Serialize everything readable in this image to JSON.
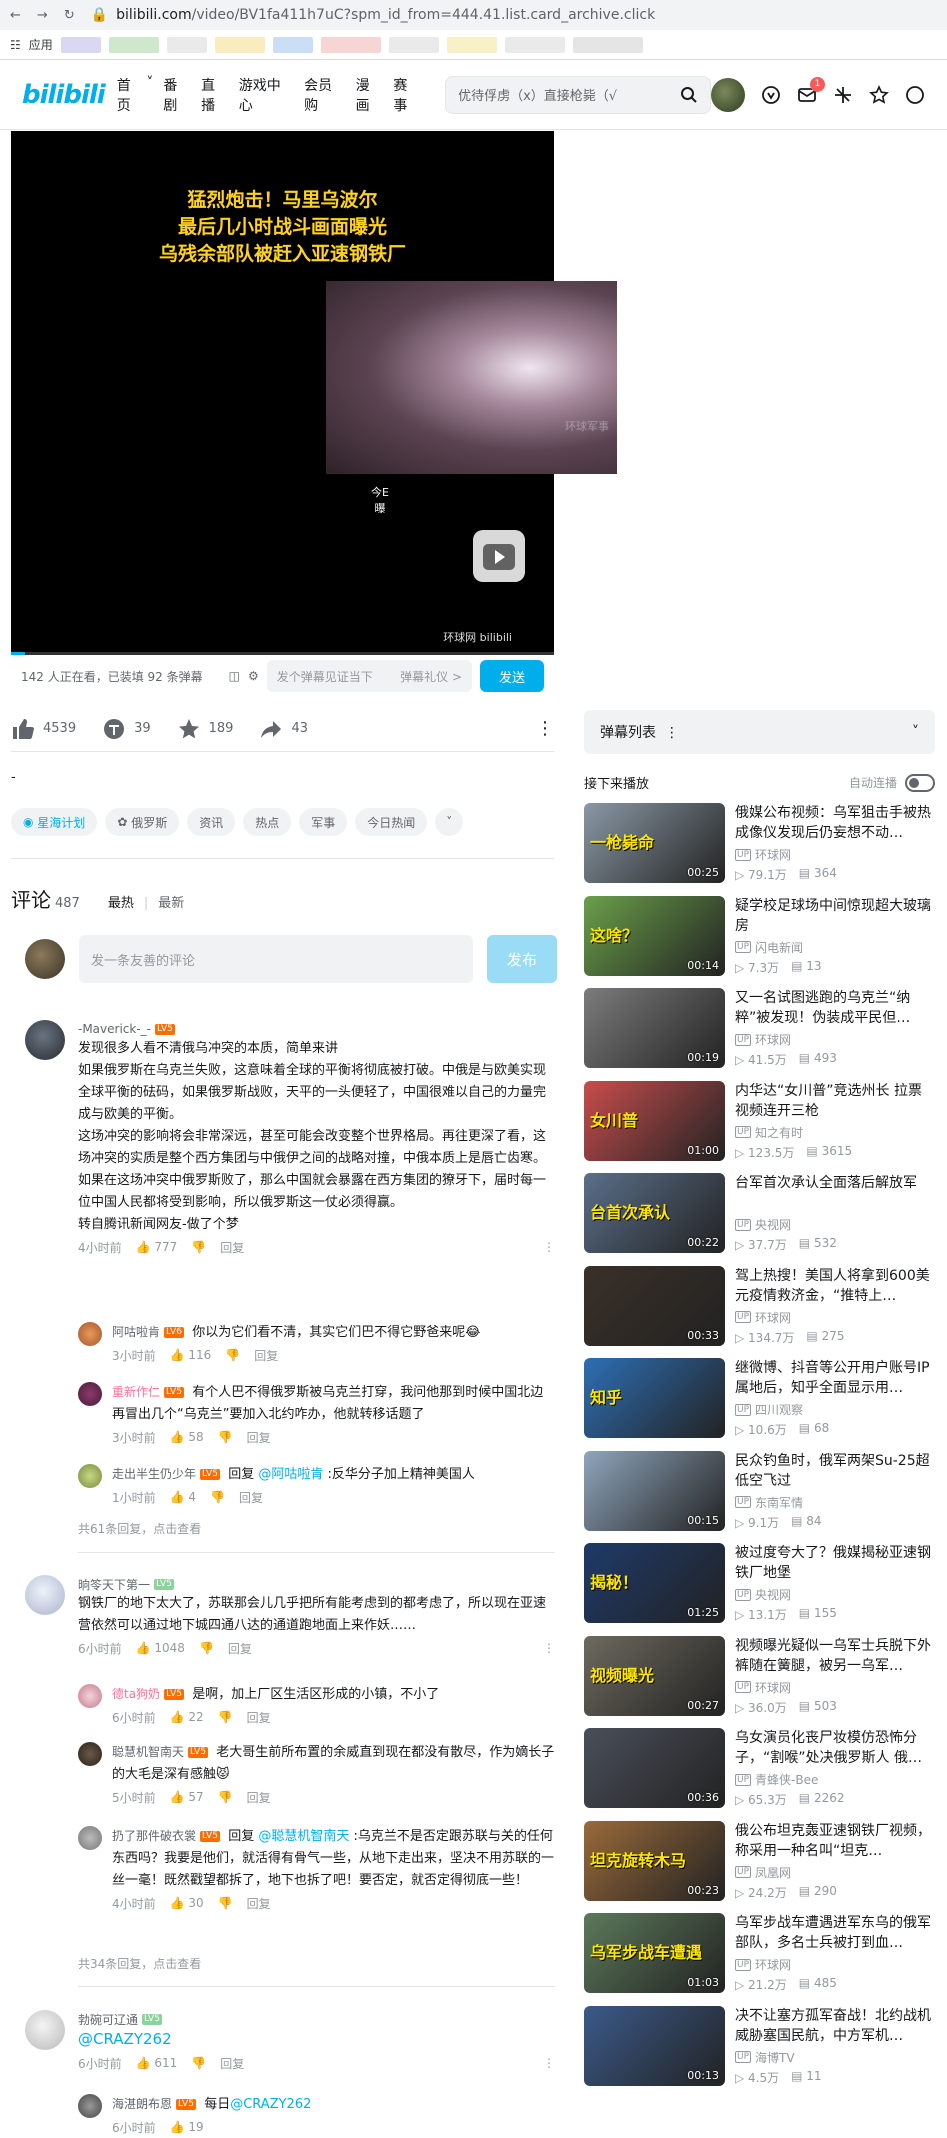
{
  "browser": {
    "url_host": "bilibili.com",
    "url_rest": "/video/BV1fa411h7uC?spm_id_from=444.41.list.card_archive.click",
    "apps_label": "应用"
  },
  "header": {
    "logo": "bilibili",
    "nav": [
      "首页",
      "番剧",
      "直播",
      "游戏中心",
      "会员购",
      "漫画",
      "赛事"
    ],
    "search_placeholder": "优待俘虏（x）直接枪毙（√",
    "badge": "1"
  },
  "player": {
    "title_lines": [
      "猛烈炮击！马里乌波尔",
      "最后几小时战斗画面曝光",
      "乌残余部队被赶入亚速钢铁厂"
    ],
    "frame_watermark": "环球军事",
    "caption_lines": [
      "今E",
      "曝"
    ],
    "watermark": "环球网 bilibili"
  },
  "danmaku_bar": {
    "watching": "142 人正在看，已装填 92 条弹幕",
    "placeholder": "发个弹幕见证当下",
    "etiquette": "弹幕礼仪 >",
    "send": "发送"
  },
  "toolbar": {
    "like": "4539",
    "coin": "39",
    "fav": "189",
    "share": "43"
  },
  "desc": "-",
  "tags": [
    "星海计划",
    "俄罗斯",
    "资讯",
    "热点",
    "军事",
    "今日热闻"
  ],
  "comments_header": {
    "title": "评论",
    "count": "487",
    "sort_hot": "最热",
    "sort_new": "最新"
  },
  "comment_input": {
    "placeholder": "发一条友善的评论",
    "button": "发布"
  },
  "comments": [
    {
      "user": "-Maverick-_-",
      "level": "LV5",
      "lines": [
        "发现很多人看不清俄乌冲突的本质，简单来讲",
        "如果俄罗斯在乌克兰失败，这意味着全球的平衡将彻底被打破。中俄是与欧美实现全球平衡的砝码，如果俄罗斯战败，天平的一头便轻了，中国很难以自己的力量完成与欧美的平衡。",
        "这场冲突的影响将会非常深远，甚至可能会改变整个世界格局。再往更深了看，这场冲突的实质是整个西方集团与中俄伊之间的战略对撞，中俄本质上是唇亡齿寒。",
        "如果在这场冲突中俄罗斯败了，那么中国就会暴露在西方集团的獠牙下，届时每一位中国人民都将受到影响，所以俄罗斯这一仗必须得赢。",
        "转自腾讯新闻网友-做了个梦"
      ],
      "time": "4小时前",
      "likes": "777",
      "reply": "回复",
      "replies": [
        {
          "user": "阿咕啦肯",
          "level": "LV6",
          "text": "你以为它们看不清，其实它们巴不得它野爸来呢😂",
          "time": "3小时前",
          "likes": "116"
        },
        {
          "user": "重新作仁",
          "level": "LV5",
          "text": "有个人巴不得俄罗斯被乌克兰打穿，我问他那到时候中国北边再冒出几个“乌克兰”要加入北约咋办，他就转移话题了",
          "time": "3小时前",
          "likes": "58"
        },
        {
          "user": "走出半生仍少年",
          "level": "LV5",
          "text_prefix": "回复 ",
          "mention": "@阿咕啦肯",
          "text": " :反华分子加上精神美国人",
          "time": "1小时前",
          "likes": "4"
        }
      ],
      "more": "共61条回复，点击查看"
    },
    {
      "user": "晌笭天下第一",
      "level": "LV5",
      "lines": [
        "钢铁厂的地下太大了，苏联那会儿几乎把所有能考虑到的都考虑了，所以现在亚速营依然可以通过地下城四通八达的通道跑地面上来作妖……"
      ],
      "time": "6小时前",
      "likes": "1048",
      "reply": "回复",
      "replies": [
        {
          "user": "德ta狗奶",
          "level": "LV5",
          "text": "是啊，加上厂区生活区形成的小镇，不小了",
          "time": "6小时前",
          "likes": "22"
        },
        {
          "user": "聪慧机智南天",
          "level": "LV5",
          "text": "老大哥生前所布置的余威直到现在都没有散尽，作为嫡长子的大毛是深有感触😾",
          "time": "5小时前",
          "likes": "57"
        },
        {
          "user": "扔了那件破衣裳",
          "level": "LV5",
          "text_prefix": "回复 ",
          "mention": "@聪慧机智南天",
          "text": " :乌克兰不是否定跟苏联与关的任何东西吗？我要是他们，就活得有骨气一些，从地下走出来，坚决不用苏联的一丝一毫！既然戳望都拆了，地下也拆了吧！要否定，就否定得彻底一些！",
          "time": "4小时前",
          "likes": "30"
        }
      ],
      "more": "共34条回复，点击查看"
    },
    {
      "user": "勃碗可辽通",
      "level": "LV5",
      "mention_line": "@CRAZY262",
      "time": "6小时前",
      "likes": "611",
      "reply": "回复",
      "replies": [
        {
          "user": "海湛朗布恩",
          "level": "LV5",
          "text": "每日",
          "mention": "@CRAZY262",
          "time": "6小时前",
          "likes": "19"
        }
      ]
    }
  ],
  "sidebar": {
    "danmaku_list": "弹幕列表",
    "next_label": "接下来播放",
    "autoplay": "自动连播",
    "recs": [
      {
        "title": "俄媒公布视频：乌军狙击手被热成像仪发现后仍妄想不动…",
        "up": "环球网",
        "views": "79.1万",
        "dm": "364",
        "dur": "00:25",
        "tt": "一枪毙命",
        "bg": "#8a99a6"
      },
      {
        "title": "疑学校足球场中间惊现超大玻璃房",
        "up": "闪电新闻",
        "views": "7.3万",
        "dm": "13",
        "dur": "00:14",
        "tt": "这啥？",
        "bg": "#6aa04a"
      },
      {
        "title": "又一名试图逃跑的乌克兰“纳粹”被发现！伪装成平民但…",
        "up": "环球网",
        "views": "41.5万",
        "dm": "493",
        "dur": "00:19",
        "tt": "",
        "bg": "#7c7c7c"
      },
      {
        "title": "内华达“女川普”竞选州长 拉票视频连开三枪",
        "up": "知之有时",
        "views": "123.5万",
        "dm": "3615",
        "dur": "01:00",
        "tt": "女川普",
        "bg": "#c94d4d"
      },
      {
        "title": "台军首次承认全面落后解放军",
        "up": "央视网",
        "views": "37.7万",
        "dm": "532",
        "dur": "00:22",
        "tt": "台首次承认",
        "bg": "#5a6f8a"
      },
      {
        "title": "驾上热搜！美国人将拿到600美元疫情救济金，“推特上…",
        "up": "环球网",
        "views": "134.7万",
        "dm": "275",
        "dur": "00:33",
        "tt": "",
        "bg": "#3a3028"
      },
      {
        "title": "继微博、抖音等公开用户账号IP属地后，知乎全面显示用…",
        "up": "四川观察",
        "views": "10.6万",
        "dm": "68",
        "dur": "",
        "tt": "知乎",
        "bg": "#2d6fb5"
      },
      {
        "title": "民众钓鱼时，俄军两架Su-25超低空飞过",
        "up": "东南军情",
        "views": "9.1万",
        "dm": "84",
        "dur": "00:15",
        "tt": "",
        "bg": "#8fa6bd"
      },
      {
        "title": "被过度夸大了？俄媒揭秘亚速钢铁厂地堡",
        "up": "央视网",
        "views": "13.1万",
        "dm": "155",
        "dur": "01:25",
        "tt": "揭秘！",
        "bg": "#1e3a6a"
      },
      {
        "title": "视频曝光疑似一乌军士兵脱下外裤随在簧腿，被另一乌军…",
        "up": "环球网",
        "views": "36.0万",
        "dm": "503",
        "dur": "00:27",
        "tt": "视频曝光",
        "bg": "#6d6a5e"
      },
      {
        "title": "乌女演员化丧尸妆模仿恐怖分子，“割喉”处决俄罗斯人 俄…",
        "up": "青蜂侠-Bee",
        "views": "65.3万",
        "dm": "2262",
        "dur": "00:36",
        "tt": "",
        "bg": "#4a4f5a"
      },
      {
        "title": "俄公布坦克轰亚速钢铁厂视频，称采用一种名叫“坦克…",
        "up": "凤凰网",
        "views": "24.2万",
        "dm": "290",
        "dur": "00:23",
        "tt": "坦克旋转木马",
        "bg": "#9a6a3a"
      },
      {
        "title": "乌军步战车遭遇进军东乌的俄军部队，多名士兵被打到血…",
        "up": "环球网",
        "views": "21.2万",
        "dm": "485",
        "dur": "01:03",
        "tt": "乌军步战车遭遇",
        "bg": "#5b7a5a"
      },
      {
        "title": "决不让塞方孤军奋战！北约战机威胁塞国民航，中方军机…",
        "up": "海博TV",
        "views": "4.5万",
        "dm": "11",
        "dur": "00:13",
        "tt": "",
        "bg": "#3a5a8a"
      }
    ]
  },
  "colors": {
    "accent": "#00aeec",
    "pink": "#fb7299",
    "level": "#ff6d00"
  }
}
